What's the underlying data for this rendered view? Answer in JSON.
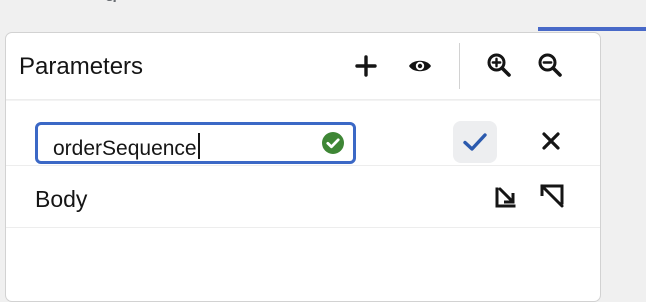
{
  "background_fragment": "g",
  "panel": {
    "title": "Parameters",
    "header_icons": [
      "plus-icon",
      "eye-icon",
      "zoom-in-icon",
      "zoom-out-icon"
    ]
  },
  "parameter_editor": {
    "value": "orderSequence",
    "status": "valid",
    "status_color": "#3e8635",
    "accent_color": "#3b68c6"
  },
  "body_row": {
    "label": "Body",
    "icons": [
      "collapse-icon",
      "expand-icon"
    ]
  }
}
